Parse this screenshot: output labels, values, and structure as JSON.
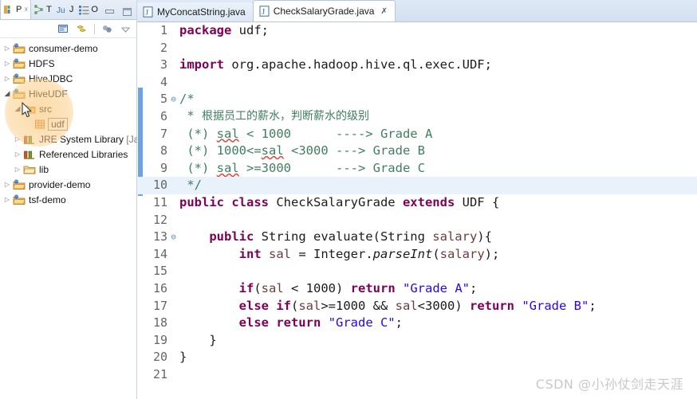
{
  "window": {
    "minimize_label": "Minimize",
    "maximize_label": "Maximize"
  },
  "left_panel": {
    "view_tabs": [
      {
        "icon": "package-explorer-icon",
        "label": "P",
        "closeable": true,
        "active": true
      },
      {
        "icon": "type-hierarchy-icon",
        "label": "T",
        "closeable": false,
        "active": false
      },
      {
        "icon": "junit-icon",
        "label": "J",
        "closeable": false,
        "active": false
      },
      {
        "icon": "outline-icon",
        "label": "O",
        "closeable": false,
        "active": false
      }
    ],
    "toolbar": [
      {
        "icon": "link-with-editor-icon",
        "tooltip": "Link with Editor"
      },
      {
        "icon": "collapse-all-icon",
        "tooltip": "Collapse All"
      },
      {
        "icon": "view-menu-icon",
        "tooltip": "View Menu"
      },
      {
        "icon": "view-dropdown-icon",
        "tooltip": "Minimize"
      }
    ],
    "tree": [
      {
        "label": "consumer-demo",
        "icon": "java-project-icon",
        "indent": 0,
        "state": "collapsed",
        "selected": false
      },
      {
        "label": "HDFS",
        "icon": "java-project-icon",
        "indent": 0,
        "state": "collapsed",
        "selected": false
      },
      {
        "label": "HiveJDBC",
        "icon": "java-project-icon",
        "indent": 0,
        "state": "collapsed",
        "selected": false
      },
      {
        "label": "HiveUDF",
        "icon": "java-project-icon",
        "indent": 0,
        "state": "expanded",
        "selected": false
      },
      {
        "label": "src",
        "icon": "source-folder-icon",
        "indent": 1,
        "state": "expanded",
        "selected": false
      },
      {
        "label": "udf",
        "icon": "package-icon",
        "indent": 2,
        "state": "leaf",
        "selected": true
      },
      {
        "label": "JRE System Library",
        "suffix": " [JavaSE-",
        "icon": "library-icon",
        "indent": 1,
        "state": "collapsed",
        "selected": false
      },
      {
        "label": "Referenced Libraries",
        "icon": "library-icon",
        "indent": 1,
        "state": "collapsed",
        "selected": false
      },
      {
        "label": "lib",
        "icon": "folder-icon",
        "indent": 1,
        "state": "collapsed",
        "selected": false
      },
      {
        "label": "provider-demo",
        "icon": "java-project-icon",
        "indent": 0,
        "state": "collapsed",
        "selected": false
      },
      {
        "label": "tsf-demo",
        "icon": "java-project-icon",
        "indent": 0,
        "state": "collapsed",
        "selected": false
      }
    ]
  },
  "editor": {
    "tabs": [
      {
        "label": "MyConcatString.java",
        "icon": "java-file-icon",
        "active": false,
        "closeable": false
      },
      {
        "label": "CheckSalaryGrade.java",
        "icon": "java-file-icon",
        "active": true,
        "closeable": true
      }
    ],
    "current_line": 10,
    "fold_markers": [
      5,
      13
    ],
    "lines": [
      {
        "n": 1,
        "tokens": [
          {
            "t": "package",
            "c": "kw"
          },
          {
            "t": " udf;",
            "c": "plain"
          }
        ]
      },
      {
        "n": 2,
        "tokens": []
      },
      {
        "n": 3,
        "tokens": [
          {
            "t": "import",
            "c": "kw"
          },
          {
            "t": " org.apache.hadoop.hive.ql.exec.UDF;",
            "c": "plain"
          }
        ]
      },
      {
        "n": 4,
        "tokens": []
      },
      {
        "n": 5,
        "tokens": [
          {
            "t": "/*",
            "c": "cmt"
          }
        ]
      },
      {
        "n": 6,
        "tokens": [
          {
            "t": " * ",
            "c": "cmt"
          },
          {
            "t": "根据员工的薪水，判断薪水的级别",
            "c": "cmt cn"
          }
        ]
      },
      {
        "n": 7,
        "tokens": [
          {
            "t": " (*) ",
            "c": "cmt"
          },
          {
            "t": "sal",
            "c": "cmt spell"
          },
          {
            "t": " < 1000      ----> Grade A",
            "c": "cmt"
          }
        ]
      },
      {
        "n": 8,
        "tokens": [
          {
            "t": " (*) 1000<=",
            "c": "cmt"
          },
          {
            "t": "sal",
            "c": "cmt spell"
          },
          {
            "t": " <3000 ---> Grade B",
            "c": "cmt"
          }
        ]
      },
      {
        "n": 9,
        "tokens": [
          {
            "t": " (*) ",
            "c": "cmt"
          },
          {
            "t": "sal",
            "c": "cmt spell"
          },
          {
            "t": " >=3000      ---> Grade C",
            "c": "cmt"
          }
        ]
      },
      {
        "n": 10,
        "tokens": [
          {
            "t": " */",
            "c": "cmt"
          }
        ]
      },
      {
        "n": 11,
        "tokens": [
          {
            "t": "public class",
            "c": "kw"
          },
          {
            "t": " CheckSalaryGrade ",
            "c": "plain"
          },
          {
            "t": "extends",
            "c": "kw"
          },
          {
            "t": " UDF {",
            "c": "plain"
          }
        ]
      },
      {
        "n": 12,
        "tokens": []
      },
      {
        "n": 13,
        "tokens": [
          {
            "t": "    ",
            "c": "plain"
          },
          {
            "t": "public",
            "c": "kw"
          },
          {
            "t": " String evaluate(String ",
            "c": "plain"
          },
          {
            "t": "salary",
            "c": "fld"
          },
          {
            "t": "){",
            "c": "plain"
          }
        ]
      },
      {
        "n": 14,
        "tokens": [
          {
            "t": "        ",
            "c": "plain"
          },
          {
            "t": "int",
            "c": "kw"
          },
          {
            "t": " ",
            "c": "plain"
          },
          {
            "t": "sal",
            "c": "fld"
          },
          {
            "t": " = Integer.",
            "c": "plain"
          },
          {
            "t": "parseInt",
            "c": "mth"
          },
          {
            "t": "(",
            "c": "plain"
          },
          {
            "t": "salary",
            "c": "fld"
          },
          {
            "t": ");",
            "c": "plain"
          }
        ]
      },
      {
        "n": 15,
        "tokens": []
      },
      {
        "n": 16,
        "tokens": [
          {
            "t": "        ",
            "c": "plain"
          },
          {
            "t": "if",
            "c": "kw"
          },
          {
            "t": "(",
            "c": "plain"
          },
          {
            "t": "sal",
            "c": "fld"
          },
          {
            "t": " < 1000) ",
            "c": "plain"
          },
          {
            "t": "return",
            "c": "kw"
          },
          {
            "t": " ",
            "c": "plain"
          },
          {
            "t": "\"Grade A\"",
            "c": "str"
          },
          {
            "t": ";",
            "c": "plain"
          }
        ]
      },
      {
        "n": 17,
        "tokens": [
          {
            "t": "        ",
            "c": "plain"
          },
          {
            "t": "else if",
            "c": "kw"
          },
          {
            "t": "(",
            "c": "plain"
          },
          {
            "t": "sal",
            "c": "fld"
          },
          {
            "t": ">=1000 && ",
            "c": "plain"
          },
          {
            "t": "sal",
            "c": "fld"
          },
          {
            "t": "<3000) ",
            "c": "plain"
          },
          {
            "t": "return",
            "c": "kw"
          },
          {
            "t": " ",
            "c": "plain"
          },
          {
            "t": "\"Grade B\"",
            "c": "str"
          },
          {
            "t": ";",
            "c": "plain"
          }
        ]
      },
      {
        "n": 18,
        "tokens": [
          {
            "t": "        ",
            "c": "plain"
          },
          {
            "t": "else return",
            "c": "kw"
          },
          {
            "t": " ",
            "c": "plain"
          },
          {
            "t": "\"Grade C\"",
            "c": "str"
          },
          {
            "t": ";",
            "c": "plain"
          }
        ]
      },
      {
        "n": 19,
        "tokens": [
          {
            "t": "    }",
            "c": "plain"
          }
        ]
      },
      {
        "n": 20,
        "tokens": [
          {
            "t": "}",
            "c": "plain"
          }
        ]
      },
      {
        "n": 21,
        "tokens": []
      }
    ]
  },
  "watermark": {
    "text": "CSDN @小孙仗剑走天涯"
  },
  "colors": {
    "keyword": "#7f0055",
    "comment": "#3f7f5f",
    "string": "#2a00ff",
    "field": "#6a3e3e",
    "current_line": "#e9f1fb",
    "fold_bar": "#6ba3e8",
    "tab_bar": "#d3e0f0"
  }
}
